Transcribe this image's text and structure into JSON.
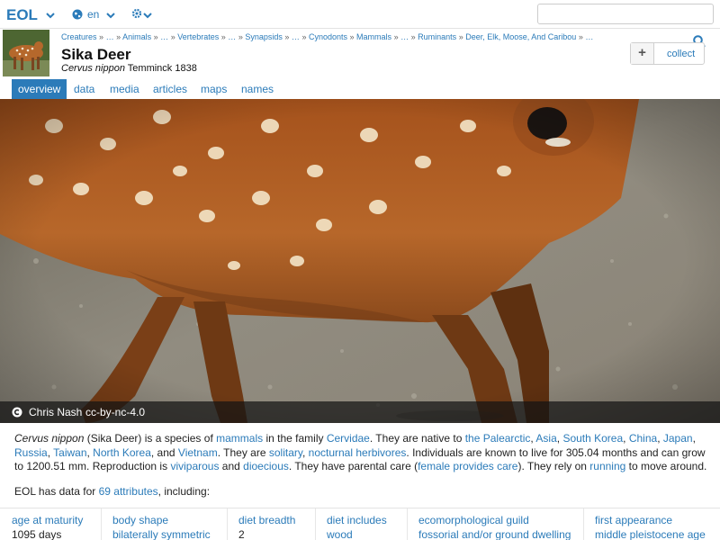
{
  "topbar": {
    "logo": "EOL",
    "language": "en",
    "search_placeholder": ""
  },
  "header": {
    "breadcrumbs": [
      "Creatures",
      "»",
      "…",
      "»",
      "Animals",
      "»",
      "…",
      "»",
      "Vertebrates",
      "»",
      "…",
      "»",
      "Synapsids",
      "»",
      "…",
      "»",
      "Cynodonts",
      "»",
      "Mammals",
      "»",
      "…",
      "»",
      "Ruminants",
      "»",
      "Deer, Elk, Moose, And Caribou",
      "»",
      "…"
    ],
    "title": "Sika Deer",
    "scientific_name": "Cervus nippon",
    "authority": "Temminck 1838",
    "collect_label": "collect",
    "collect_plus": "+"
  },
  "tabs": [
    "overview",
    "data",
    "media",
    "articles",
    "maps",
    "names"
  ],
  "media": {
    "author": "Chris Nash",
    "license": "cc-by-nc-4.0"
  },
  "summary": {
    "p1": "Cervus nippon",
    "p2": " (Sika Deer) is a species of ",
    "l_mammals": "mammals",
    "p3": " in the family ",
    "l_cervidae": "Cervidae",
    "p4": ". They are native to ",
    "l_palearctic": "the Palearctic",
    "c1": ", ",
    "l_asia": "Asia",
    "c2": ", ",
    "l_skorea": "South Korea",
    "c3": ", ",
    "l_china": "China",
    "c4": ", ",
    "l_japan": "Japan",
    "c5": ", ",
    "l_russia": "Russia",
    "c6": ", ",
    "l_taiwan": "Taiwan",
    "c7": ", ",
    "l_nkorea": "North Korea",
    "c8": ", and ",
    "l_vietnam": "Vietnam",
    "p5": ". They are ",
    "l_solitary": "solitary",
    "c9": ", ",
    "l_nocturnal": "nocturnal",
    "sp1": " ",
    "l_herbivores": "herbivores",
    "p6": ". Individuals are known to live for 305.04 months and can grow to 1200.51 mm. Reproduction is ",
    "l_viviparous": "viviparous",
    "p7": " and ",
    "l_dioecious": "dioecious",
    "p8": ". They have parental care (",
    "l_female": "female provides care",
    "p9": "). They rely on ",
    "l_running": "running",
    "p10": " to move around.",
    "eol_prefix": "EOL has data for ",
    "eol_link": "69 attributes",
    "eol_suffix": ", including:"
  },
  "attributes": [
    {
      "name": "age at maturity",
      "value": "1095 days",
      "value_link": false
    },
    {
      "name": "body shape",
      "value": "bilaterally symmetric",
      "value_link": true
    },
    {
      "name": "diet breadth",
      "value": "2",
      "value_link": false
    },
    {
      "name": "diet includes",
      "value": "wood",
      "value_link": true
    },
    {
      "name": "ecomorphological guild",
      "value": "fossorial and/or ground dwelling",
      "value_link": true
    },
    {
      "name": "first appearance",
      "value": "middle pleistocene age",
      "value_link": true
    }
  ],
  "colors": {
    "link": "#2b7bb9",
    "tab_active_bg": "#2b7bb9"
  }
}
